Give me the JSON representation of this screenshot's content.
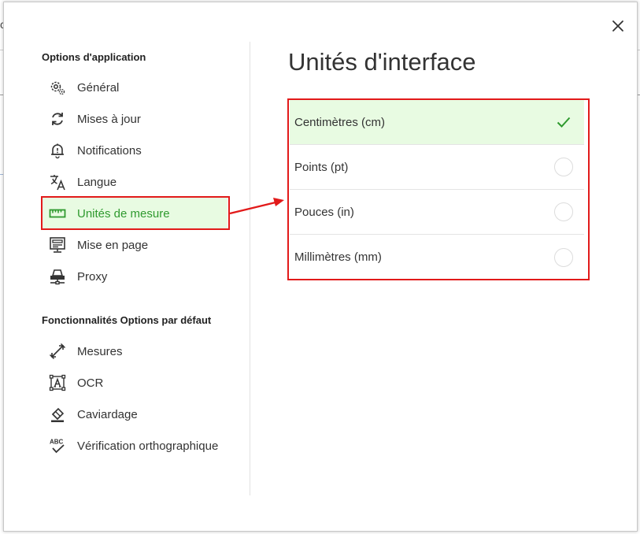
{
  "dialog": {
    "close_icon": "close-icon"
  },
  "sidebar": {
    "section1_title": "Options d'application",
    "section2_title": "Fonctionnalités Options par défaut",
    "items": [
      {
        "label": "Général",
        "icon": "gear-icon"
      },
      {
        "label": "Mises à jour",
        "icon": "refresh-icon"
      },
      {
        "label": "Notifications",
        "icon": "bell-icon"
      },
      {
        "label": "Langue",
        "icon": "translate-icon"
      },
      {
        "label": "Unités de mesure",
        "icon": "ruler-icon",
        "active": true
      },
      {
        "label": "Mise en page",
        "icon": "layout-icon"
      },
      {
        "label": "Proxy",
        "icon": "network-icon"
      }
    ],
    "features": [
      {
        "label": "Mesures",
        "icon": "measure-icon"
      },
      {
        "label": "OCR",
        "icon": "ocr-icon"
      },
      {
        "label": "Caviardage",
        "icon": "redact-icon"
      },
      {
        "label": "Vérification orthographique",
        "icon": "spellcheck-icon"
      }
    ]
  },
  "main": {
    "title": "Unités d'interface",
    "options": [
      {
        "label": "Centimètres (cm)",
        "selected": true
      },
      {
        "label": "Points (pt)",
        "selected": false
      },
      {
        "label": "Pouces (in)",
        "selected": false
      },
      {
        "label": "Millimètres (mm)",
        "selected": false
      }
    ]
  },
  "colors": {
    "accent": "#2e9a2e",
    "active_bg": "#e8fbe2",
    "annotation": "#e21a1a"
  }
}
